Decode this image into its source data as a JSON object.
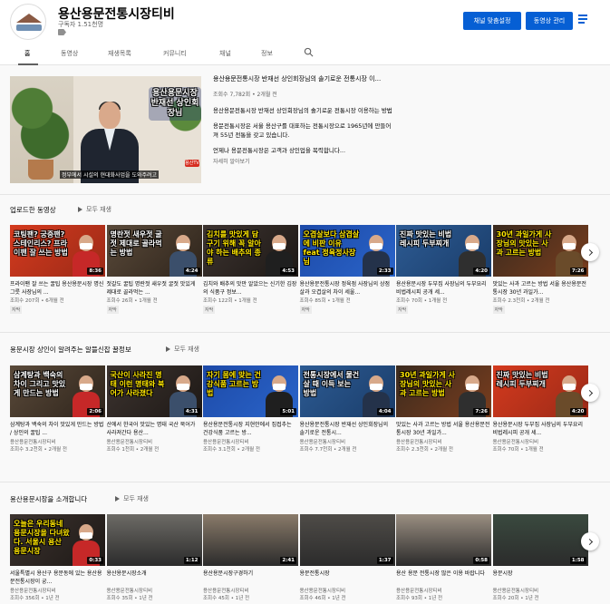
{
  "header": {
    "channel_name": "용산용문전통시장티비",
    "subscribers": "구독자 1.51천명",
    "customize_button": "채널 맞춤설정",
    "manage_button": "동영상 관리"
  },
  "tabs": [
    "홈",
    "동영상",
    "재생목록",
    "커뮤니티",
    "채널",
    "정보"
  ],
  "featured": {
    "caption": "용산용문시장 반재선 상인회장님",
    "subtitle": "정부에서 시설의 현대화사업을 도와주려고",
    "logo": "용산TV",
    "title": "용산용문전통시장 반재선 상인회장님의 솔기로운 전통시장 이...",
    "meta": "조회수 7,782회 • 2개월 전",
    "desc1": "용산용문전통시장 반재선 상인회장님의 솔기로운 전통시장 이용하는 방법",
    "desc2": "용문전통시장은 서울 용산구를 대표하는 전통시장으로 1965년에 만들어져 55년 전통을 갖고 있습니다.",
    "desc3": "언제나 용문전통시장은 고객과 상인업을 복력합니다...",
    "more": "자세히 알아보기"
  },
  "sections": [
    {
      "title": "업로드한 동영상",
      "play_all": "모두 재생",
      "videos": [
        {
          "thumb": "코팅팬? 궁중팬? 스테인리스? 프라이팬 잘 쓰는 방법",
          "duration": "8:36",
          "title": "프라이팬 잘 쓰는 꿀팁 용산용문시장 명신그릇 사장님의 ...",
          "channel": "",
          "meta": "조회수 207회 • 6개월 전",
          "badge": "자막"
        },
        {
          "thumb": "명란젓 새우젓 굴젓 제대로 골라먹는 방법",
          "duration": "4:24",
          "title": "젓갈도 꿀팁 명란젓 새우젓 굴젓 맛있게 제대로 골라먹는 ...",
          "channel": "",
          "meta": "조회수 26회 • 1개월 전",
          "badge": "자막"
        },
        {
          "thumb": "김치를 맛있게 담구기 위해 꼭 알아야 하는 배추의 종류",
          "duration": "4:53",
          "title": "김치와 배추의 맛만 알았으는 신기한 김장의 식품구 정보...",
          "channel": "",
          "meta": "조회수 122회 • 1개월 전",
          "badge": "자막"
        },
        {
          "thumb": "오겹살보다 삼겹살에 비판 이유 feat 정육정사장님",
          "duration": "2:33",
          "title": "용산용문전통시장 정육점 사장님의 상점살과 오겹살의 차이 세울...",
          "channel": "",
          "meta": "조회수 85회 • 1개월 전",
          "badge": "자막"
        },
        {
          "thumb": "진짜 맛있는 비법 레시피 두부찌개",
          "duration": "4:20",
          "title": "용산용문시장 두부집 사장님의 두부요리 비법레시피 공개 세...",
          "channel": "",
          "meta": "조회수 70회 • 1개월 전",
          "badge": "자막"
        },
        {
          "thumb": "30년 과일가게 사장님의 맛있는 사과 고르는 방법",
          "duration": "7:26",
          "title": "맛있는 사과 고르는 방법 서울 용산용문전통시장 30년 과일가...",
          "channel": "",
          "meta": "조회수 2.3천회 • 2개월 전",
          "badge": "자막"
        }
      ]
    },
    {
      "title": "용문시장 상인이 알려주는 알뜰신잡 꿀정보",
      "play_all": "모두 재생",
      "videos": [
        {
          "thumb": "삼계탕과 백숙의 차이 그리고 맛있게 만드는 방법",
          "duration": "2:06",
          "title": "삼계탕과 백숙의 차이 맛있게 만드는 방법 / 상인의 꿀팁 ...",
          "channel": "용산용문전통시장티비",
          "meta": "조회수 3.2천회 • 2개월 전",
          "badge": ""
        },
        {
          "thumb": "국산이 사라진 명태 이런 명태와 북어가 사라졌다",
          "duration": "4:31",
          "title": "산에서 한국어 맛있는 명태 국산 북어가 사라져간다 용산...",
          "channel": "용산용문전통시장티비",
          "meta": "조회수 1천회 • 2개월 전",
          "badge": ""
        },
        {
          "thumb": "자기 몸에 맞는 건강식품 고르는 방법",
          "duration": "5:01",
          "title": "용산용문전통시장 지현안에서 집접추는 건강식품 고르는 방...",
          "channel": "용산용문전통시장티비",
          "meta": "조회수 3.1천회 • 2개월 전",
          "badge": ""
        },
        {
          "thumb": "전통시장에서 물건 살 때 이득 보는 방법",
          "duration": "4:04",
          "title": "용산용문전통시장 반재선 상인회장님의 솔기로운 전통시...",
          "channel": "용산용문전통시장티비",
          "meta": "조회수 7.7천회 • 2개월 전",
          "badge": ""
        },
        {
          "thumb": "30년 과일가게 사장님의 맛있는 사과 고르는 방법",
          "duration": "7:26",
          "title": "맛있는 사과 고르는 방법 서울 용산용문전통시장 30년 과일가...",
          "channel": "용산용문전통시장티비",
          "meta": "조회수 2.3천회 • 2개월 전",
          "badge": ""
        },
        {
          "thumb": "진짜 맛있는 비법 레시피 두부찌개",
          "duration": "4:20",
          "title": "용산용문시장 두부집 사장님의 두부요리 비법레시피 공개 세...",
          "channel": "용산용문전통시장티비",
          "meta": "조회수 70회 • 1개월 전",
          "badge": ""
        }
      ]
    },
    {
      "title": "용산용문시장을 소개합니다",
      "play_all": "모두 재생",
      "videos": [
        {
          "thumb": "오늘은 우리동네 용문시장을 다녀왔다. 서울시 용산 용문시장",
          "duration": "0:33",
          "title": "서울특별시 용산구 용문동에 있는 용산용문전통시장이 궁...",
          "channel": "용산용문전통시장티비",
          "meta": "조회수 356회 • 1년 전",
          "badge": ""
        },
        {
          "thumb": "",
          "duration": "1:12",
          "title": "용산용문시장소개",
          "channel": "용산용문전통시장티비",
          "meta": "조회수 35회 • 1년 전",
          "badge": ""
        },
        {
          "thumb": "",
          "duration": "2:41",
          "title": "용산용문시장구경하기",
          "channel": "용산용문전통시장티비",
          "meta": "조회수 45회 • 1년 전",
          "badge": ""
        },
        {
          "thumb": "",
          "duration": "1:37",
          "title": "용문전통시장",
          "channel": "용산용문전통시장티비",
          "meta": "조회수 46회 • 1년 전",
          "badge": ""
        },
        {
          "thumb": "",
          "duration": "0:58",
          "title": "용산 용문 전통시장 많은 이용 바랍니다",
          "channel": "용산용문전통시장티비",
          "meta": "조회수 93회 • 1년 전",
          "badge": ""
        },
        {
          "thumb": "",
          "duration": "1:58",
          "title": "용문시장",
          "channel": "용산용문전통시장티비",
          "meta": "조회수 20회 • 1년 전",
          "badge": ""
        }
      ]
    }
  ]
}
